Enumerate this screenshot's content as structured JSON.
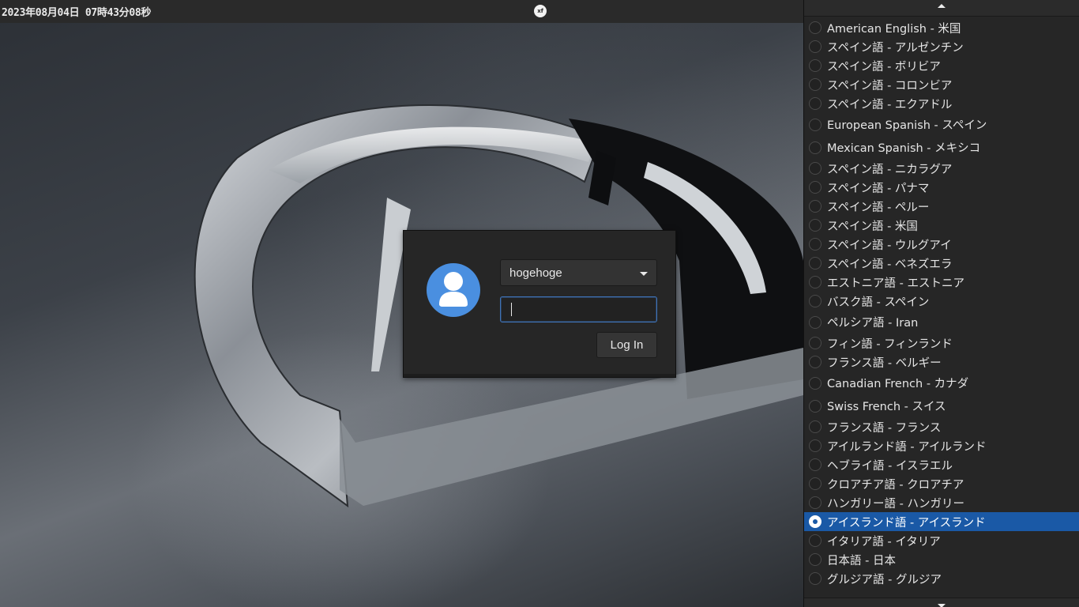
{
  "topbar": {
    "clock": "2023年08月04日 07時43分08秒",
    "xf_icon_text": "xf"
  },
  "login": {
    "username": "hogehoge",
    "password_value": "",
    "login_label": "Log In"
  },
  "language_menu": {
    "selected_index": 25,
    "items": [
      {
        "label": "American English - 米国",
        "tall": false
      },
      {
        "label": "スペイン語 - アルゼンチン",
        "tall": false
      },
      {
        "label": "スペイン語 - ボリビア",
        "tall": false
      },
      {
        "label": "スペイン語 - コロンビア",
        "tall": false
      },
      {
        "label": "スペイン語 - エクアドル",
        "tall": false
      },
      {
        "label": "European Spanish - スペイン",
        "tall": true
      },
      {
        "label": "Mexican Spanish - メキシコ",
        "tall": true
      },
      {
        "label": "スペイン語 - ニカラグア",
        "tall": false
      },
      {
        "label": "スペイン語 - パナマ",
        "tall": false
      },
      {
        "label": "スペイン語 - ペルー",
        "tall": false
      },
      {
        "label": "スペイン語 - 米国",
        "tall": false
      },
      {
        "label": "スペイン語 - ウルグアイ",
        "tall": false
      },
      {
        "label": "スペイン語 - ベネズエラ",
        "tall": false
      },
      {
        "label": "エストニア語 - エストニア",
        "tall": false
      },
      {
        "label": "バスク語 - スペイン",
        "tall": false
      },
      {
        "label": "ペルシア語 - Iran",
        "tall": true
      },
      {
        "label": "フィン語 - フィンランド",
        "tall": false
      },
      {
        "label": "フランス語 - ベルギー",
        "tall": false
      },
      {
        "label": "Canadian French - カナダ",
        "tall": true
      },
      {
        "label": "Swiss French - スイス",
        "tall": true
      },
      {
        "label": "フランス語 - フランス",
        "tall": false
      },
      {
        "label": "アイルランド語 - アイルランド",
        "tall": false
      },
      {
        "label": "ヘブライ語 - イスラエル",
        "tall": false
      },
      {
        "label": "クロアチア語 - クロアチア",
        "tall": false
      },
      {
        "label": "ハンガリー語 - ハンガリー",
        "tall": false
      },
      {
        "label": "アイスランド語 - アイスランド",
        "tall": false
      },
      {
        "label": "イタリア語 - イタリア",
        "tall": false
      },
      {
        "label": "日本語 - 日本",
        "tall": false
      },
      {
        "label": "グルジア語 - グルジア",
        "tall": false
      }
    ]
  },
  "colors": {
    "accent": "#1a59a6",
    "avatar_bg": "#4a8fe0",
    "focus_border": "#3f73b8"
  }
}
